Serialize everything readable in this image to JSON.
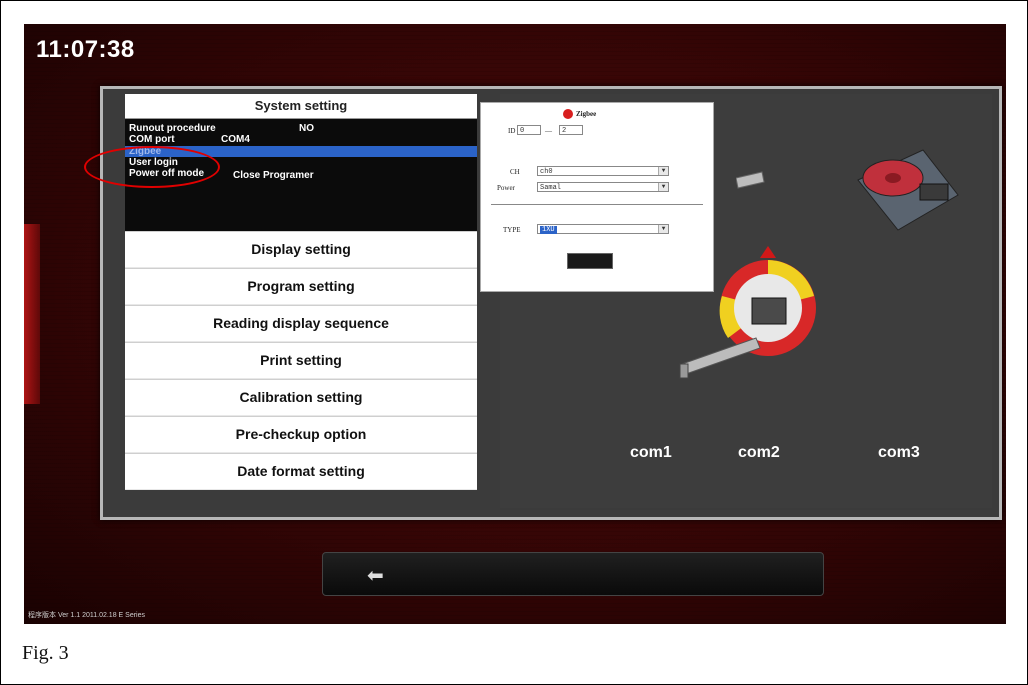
{
  "clock": "11:07:38",
  "system": {
    "title": "System setting",
    "rows": [
      {
        "label": "Runout procedure",
        "value": "NO"
      },
      {
        "label": "COM port",
        "value": "COM4"
      },
      {
        "label": "Zigbee",
        "value": ""
      },
      {
        "label": "User login",
        "value": ""
      },
      {
        "label": "Power off mode",
        "value": "Close Programer"
      }
    ]
  },
  "menu": [
    "Display setting",
    "Program setting",
    "Reading display sequence",
    "Print setting",
    "Calibration setting",
    "Pre-checkup option",
    "Date format setting"
  ],
  "dialog": {
    "logo_text": "Zigbee",
    "id_label": "ID",
    "id_from": "0",
    "id_sep": "—",
    "id_to": "2",
    "ch_label": "CH",
    "ch_value": "ch0",
    "power_label": "Power",
    "power_value": "Samal",
    "type_label": "TYPE",
    "type_value": "1XU"
  },
  "com_labels": [
    "com1",
    "com2",
    "com3"
  ],
  "footer": "程序版本 Ver 1.1   2011.02.18 E Series",
  "caption": "Fig. 3",
  "colors": {
    "accent_red": "#e00000",
    "selection_blue": "#2b63c8"
  }
}
